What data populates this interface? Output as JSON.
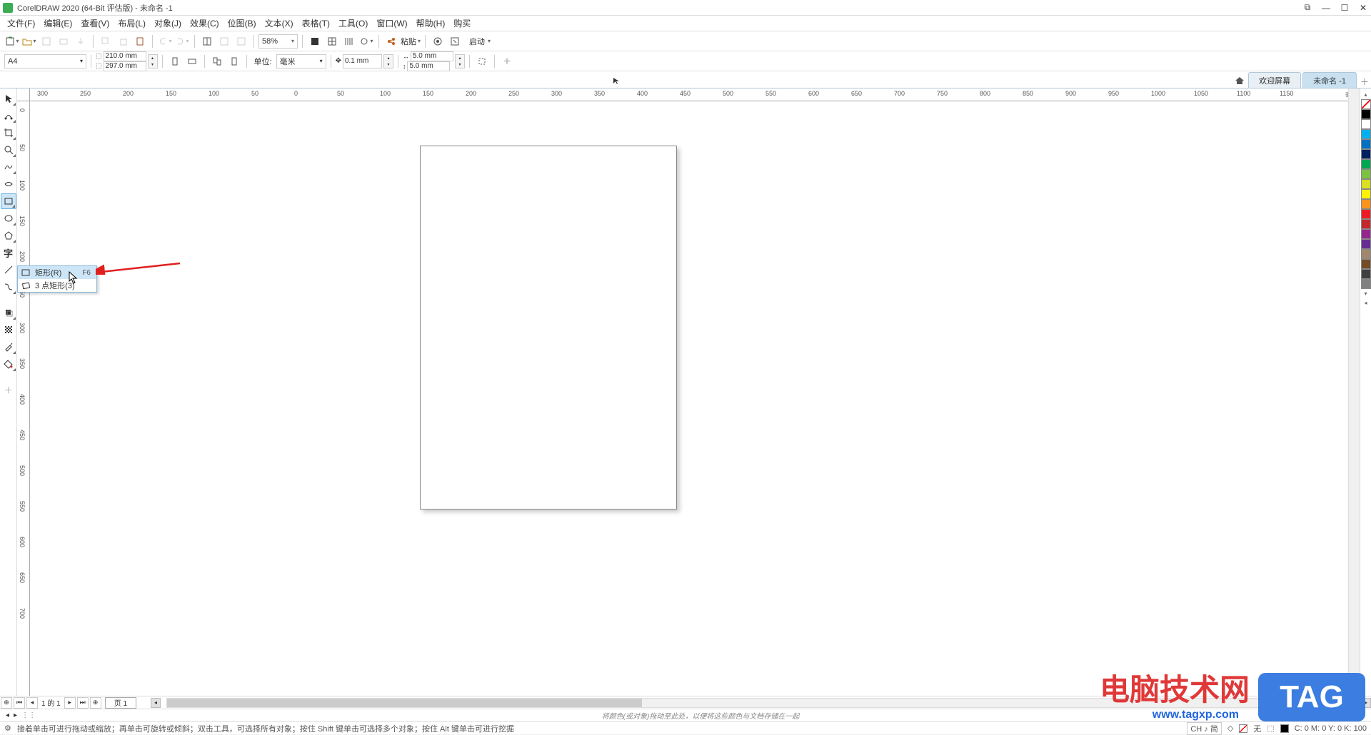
{
  "title": "CorelDRAW 2020 (64-Bit 评估版) - 未命名 -1",
  "menu": {
    "file": "文件(F)",
    "edit": "编辑(E)",
    "view": "查看(V)",
    "layout": "布局(L)",
    "object": "对象(J)",
    "effects": "效果(C)",
    "bitmaps": "位图(B)",
    "text": "文本(X)",
    "table": "表格(T)",
    "tools": "工具(O)",
    "window": "窗口(W)",
    "help": "帮助(H)",
    "buy": "购买"
  },
  "toolbar1": {
    "zoom": "58%",
    "copy_label": "粘贴",
    "start_label": "启动"
  },
  "toolbar2": {
    "page_preset": "A4",
    "width": "210.0 mm",
    "height": "297.0 mm",
    "unit_label": "单位:",
    "unit_value": "毫米",
    "nudge": "0.1 mm",
    "dup_x": "5.0 mm",
    "dup_y": "5.0 mm"
  },
  "tabs": {
    "welcome": "欢迎屏幕",
    "doc1": "未命名 -1"
  },
  "ruler": {
    "unit_hint": "毫米",
    "h_ticks": [
      "300",
      "250",
      "200",
      "150",
      "100",
      "50",
      "0",
      "50",
      "100",
      "150",
      "200",
      "250",
      "300",
      "350",
      "400",
      "450",
      "500",
      "550",
      "600",
      "650",
      "700",
      "750",
      "800",
      "850",
      "900",
      "950",
      "1000",
      "1050",
      "1100",
      "1150"
    ],
    "v_ticks": [
      "0",
      "50",
      "100",
      "150",
      "200",
      "250",
      "300",
      "350",
      "400",
      "450",
      "500",
      "550",
      "600",
      "650",
      "700"
    ]
  },
  "flyout": {
    "rect_label": "矩形(R)",
    "rect_shortcut": "F6",
    "three_point_label": "3 点矩形(3)"
  },
  "page_nav": {
    "counter": "1 的 1",
    "page1": "页 1"
  },
  "hint_row": {
    "drag_hint": "将颜色(或对象)拖动至此处，以便将这些颜色与文档存储在一起"
  },
  "status": {
    "help_text": "接着单击可进行拖动或缩放；再单击可旋转或倾斜；双击工具，可选择所有对象；按住 Shift 键单击可选择多个对象；按住 Alt 键单击可进行挖掘",
    "lang": "CH ♪ 简",
    "fill": "无",
    "color_info": "C: 0 M: 0 Y: 0 K: 100"
  },
  "colors": [
    "#000000",
    "#ffffff",
    "#00b0f0",
    "#0070c0",
    "#002060",
    "#00a651",
    "#7ec242",
    "#d9e021",
    "#fff200",
    "#f7931e",
    "#ed1c24",
    "#c1272d",
    "#93278f",
    "#662d91",
    "#a2876d",
    "#754c24",
    "#404040",
    "#808080"
  ],
  "watermark": {
    "main": "电脑技术网",
    "url": "www.tagxp.com",
    "tag": "TAG"
  }
}
